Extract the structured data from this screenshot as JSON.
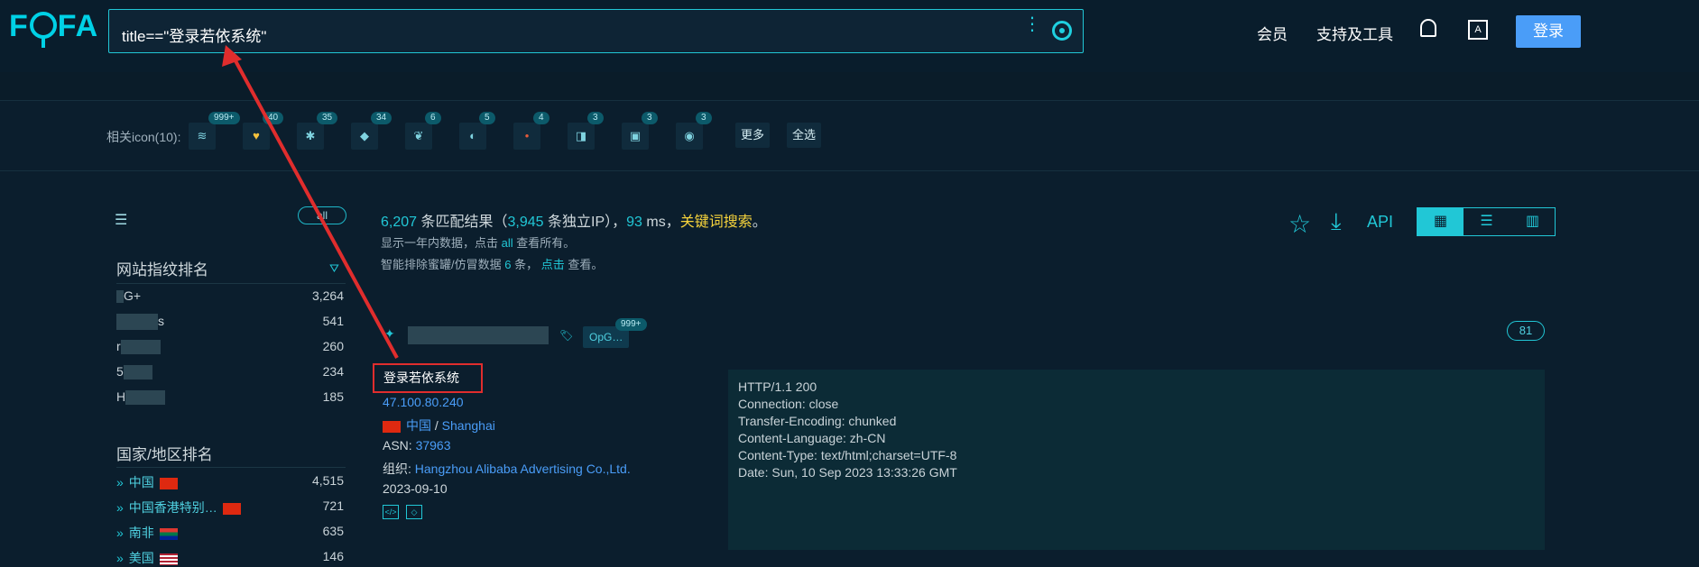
{
  "header": {
    "logo": "FOFA",
    "query": "title==\"登录若依系统\"",
    "nav": [
      "会员",
      "支持及工具"
    ],
    "login_label": "登录",
    "translate_glyph": "A"
  },
  "icons": {
    "label": "相关icon(10):",
    "items": [
      {
        "count": "999+",
        "glyph": "≋"
      },
      {
        "count": "40",
        "glyph": "♥"
      },
      {
        "count": "35",
        "glyph": "✱"
      },
      {
        "count": "34",
        "glyph": "◆"
      },
      {
        "count": "6",
        "glyph": "❦"
      },
      {
        "count": "5",
        "glyph": "◐"
      },
      {
        "count": "4",
        "glyph": "•"
      },
      {
        "count": "3",
        "glyph": "◨"
      },
      {
        "count": "3",
        "glyph": "▣"
      },
      {
        "count": "3",
        "glyph": "◉"
      }
    ],
    "more_label": "更多",
    "select_all_label": "全选"
  },
  "sidebar": {
    "all_label": "all",
    "fingerprint_title": "网站指纹排名",
    "fingerprints": [
      {
        "label": "G+",
        "count": "3,264"
      },
      {
        "label": "s",
        "count": "541"
      },
      {
        "label": "r",
        "count": "260"
      },
      {
        "label": "5",
        "count": "234"
      },
      {
        "label": "H",
        "count": "185"
      }
    ],
    "country_title": "国家/地区排名",
    "countries": [
      {
        "name": "中国",
        "count": "4,515",
        "flag": "#de2910"
      },
      {
        "name": "中国香港特别…",
        "count": "721",
        "flag": "#de2910"
      },
      {
        "name": "南非",
        "count": "635",
        "flag": "#007749"
      },
      {
        "name": "美国",
        "count": "146",
        "flag": "#b22234"
      }
    ]
  },
  "results": {
    "count": "6,207",
    "count_suffix": "条匹配结果（",
    "ips": "3,945",
    "ips_suffix": "条独立IP），",
    "ms": "93",
    "ms_suffix": "ms，",
    "keyword_search": "关键词搜索",
    "period": "。",
    "sub1_a": "显示一年内数据，点击",
    "sub1_link": "all",
    "sub1_b": "查看所有。",
    "sub2_a": "智能排除蜜罐/仿冒数据",
    "sub2_num": "6",
    "sub2_b": "条，",
    "sub2_link": "点击",
    "sub2_c": "查看。",
    "api_label": "API"
  },
  "record": {
    "tag": "OpG…",
    "tag_count": "999+",
    "badge": "81",
    "title": "登录若依系统",
    "ip": "47.100.80.240",
    "country": "中国",
    "sep": "/",
    "city": "Shanghai",
    "asn_label": "ASN:",
    "asn": "37963",
    "org_label": "组织:",
    "org": "Hangzhou Alibaba Advertising Co.,Ltd.",
    "date": "2023-09-10",
    "headers": [
      "HTTP/1.1 200",
      "Connection: close",
      "Transfer-Encoding: chunked",
      "Content-Language: zh-CN",
      "Content-Type: text/html;charset=UTF-8",
      "Date: Sun, 10 Sep 2023 13:33:26 GMT"
    ]
  }
}
